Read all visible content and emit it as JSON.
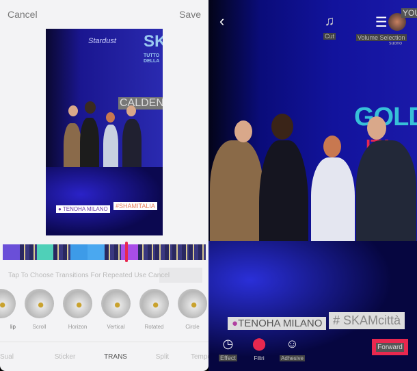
{
  "editor": {
    "cancel": "Cancel",
    "save": "Save",
    "preview": {
      "logo": "Stardust",
      "sk": "SK",
      "sub1": "TUTTO",
      "sub2": "DELLA",
      "caption": "CALDENI",
      "tag_location": "● TENOHA MILANO",
      "tag_hashtag": "#SHAMITALIA"
    },
    "timeline_colors": [
      "#6a4fd8",
      "#28264a",
      "#4fd0b8",
      "#28264a",
      "#3d9be8",
      "#4aa8f0",
      "#28264a",
      "#a94de8",
      "#28264a",
      "#28264a",
      "#28264a",
      "#28264a"
    ],
    "playhead_progress": 0.61,
    "hint": "Tap To Choose Transitions For Repeated Use Cancel",
    "transitions": [
      {
        "label": "lip"
      },
      {
        "label": "Scroll"
      },
      {
        "label": "Horizon"
      },
      {
        "label": "Vertical"
      },
      {
        "label": "Rotated"
      },
      {
        "label": "Circle"
      }
    ],
    "tabs": [
      {
        "label": "Sual"
      },
      {
        "label": "Sticker"
      },
      {
        "label": "TRANS",
        "active": true
      },
      {
        "label": "Split"
      },
      {
        "label": "Tempo"
      }
    ]
  },
  "player": {
    "back_icon": "chevron-left-icon",
    "stage_text": "GOLDEN",
    "stage_text2": "ITA",
    "you": "YOU",
    "tools": {
      "cut": "Cut",
      "volume": "Volume Selection",
      "suono": "suono"
    },
    "tag_location": "TENOHA MILANO",
    "tag_hashtag": "# SKAMcittà",
    "bottom": {
      "effect": "Effect",
      "filters": "Filtri",
      "adhesive": "Adhesive"
    },
    "forward": "Forward",
    "accent": "#e8284f"
  }
}
